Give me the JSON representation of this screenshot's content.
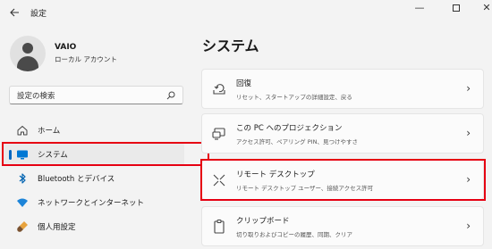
{
  "window": {
    "title": "設定",
    "back_icon": "arrow-left-icon",
    "minimize_glyph": "—",
    "close_glyph": "✕"
  },
  "account": {
    "name": "VAIO",
    "type": "ローカル アカウント"
  },
  "search": {
    "placeholder": "設定の検索"
  },
  "nav": {
    "items": [
      {
        "label": "ホーム",
        "icon": "home-icon"
      },
      {
        "label": "システム",
        "icon": "monitor-icon",
        "active": true
      },
      {
        "label": "Bluetooth とデバイス",
        "icon": "bluetooth-icon"
      },
      {
        "label": "ネットワークとインターネット",
        "icon": "wifi-icon"
      },
      {
        "label": "個人用設定",
        "icon": "brush-icon"
      }
    ]
  },
  "main": {
    "title": "システム",
    "cards": [
      {
        "title": "回復",
        "desc": "リセット、スタートアップの詳細設定、戻る",
        "icon": "recovery-icon"
      },
      {
        "title": "この PC へのプロジェクション",
        "desc": "アクセス許可、ペアリング PIN、見つけやすさ",
        "icon": "projection-icon"
      },
      {
        "title": "リモート デスクトップ",
        "desc": "リモート デスクトップ ユーザー、接続アクセス許可",
        "icon": "remote-desktop-icon"
      },
      {
        "title": "クリップボード",
        "desc": "切り取りおよびコピーの履歴、同期、クリア",
        "icon": "clipboard-icon"
      }
    ]
  },
  "colors": {
    "accent": "#0067c0",
    "highlight_box": "#e60012",
    "background": "#f3f3f3"
  }
}
